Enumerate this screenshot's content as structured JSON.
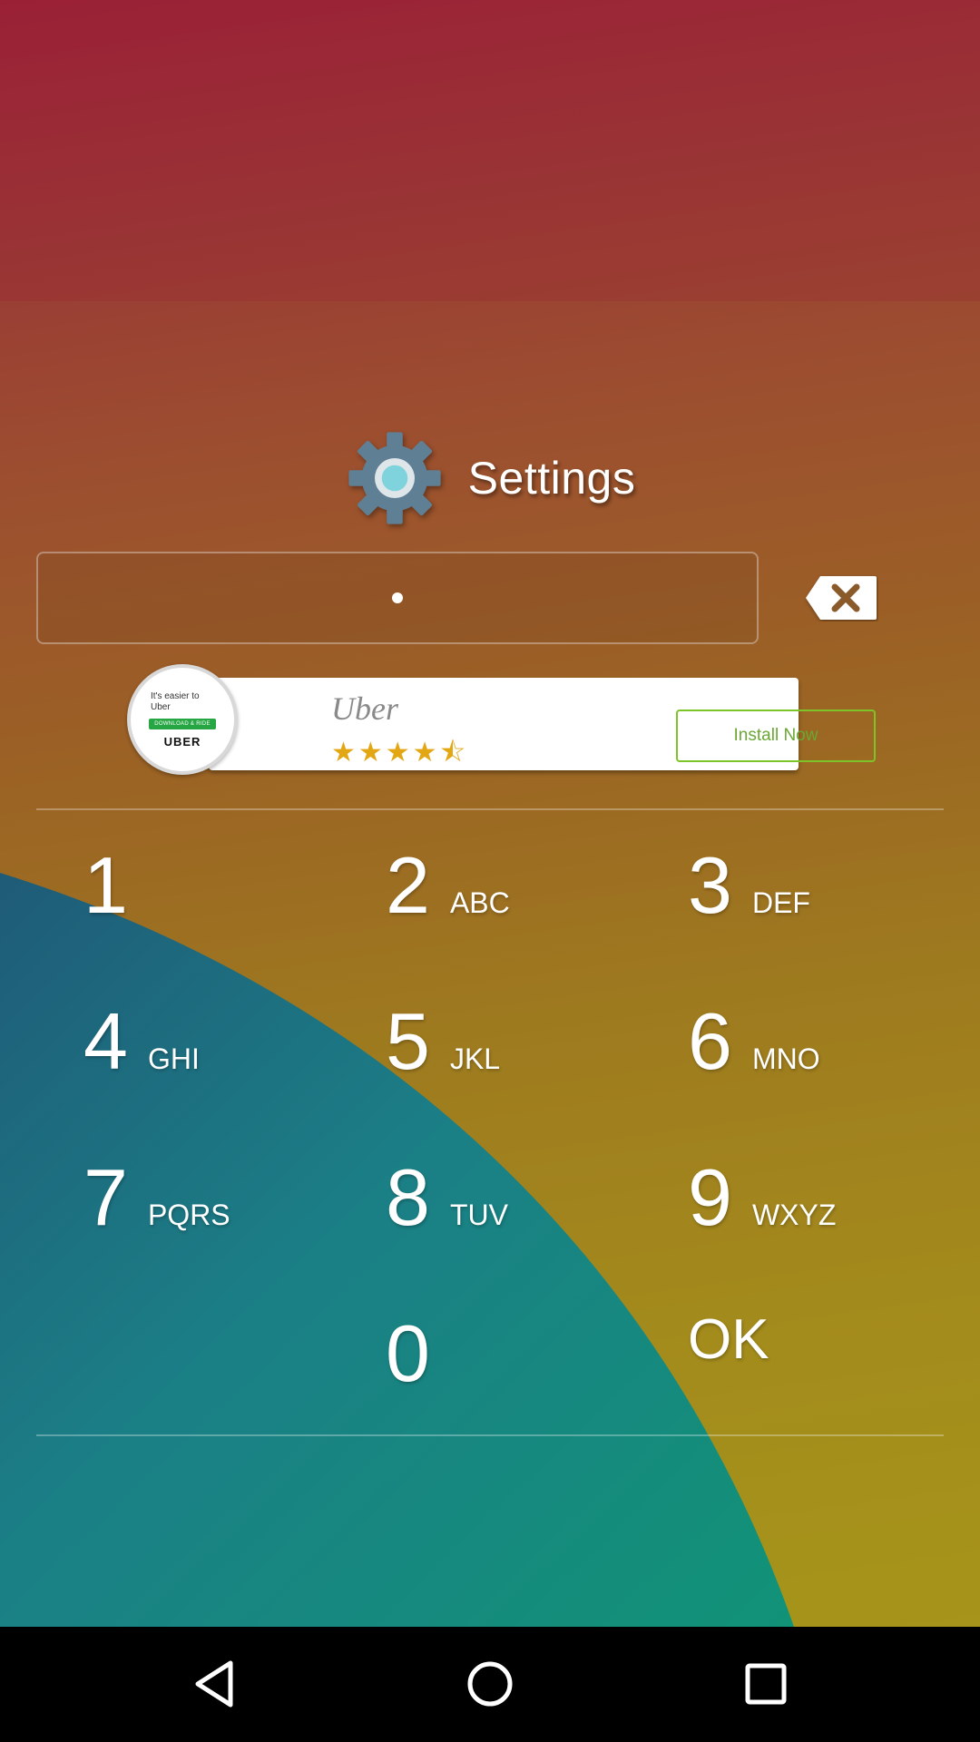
{
  "header": {
    "title": "Settings",
    "icon": "gear-icon"
  },
  "pin": {
    "masked_value": "•"
  },
  "ad": {
    "badge_tagline": "It's easier to Uber",
    "badge_button": "DOWNLOAD & RIDE",
    "badge_logo": "UBER",
    "app_name": "Uber",
    "stars": "★★★★⯪",
    "rating_stars": 4.5,
    "install_label": "Install Now"
  },
  "keypad": [
    {
      "digit": "1",
      "letters": ""
    },
    {
      "digit": "2",
      "letters": "ABC"
    },
    {
      "digit": "3",
      "letters": "DEF"
    },
    {
      "digit": "4",
      "letters": "GHI"
    },
    {
      "digit": "5",
      "letters": "JKL"
    },
    {
      "digit": "6",
      "letters": "MNO"
    },
    {
      "digit": "7",
      "letters": "PQRS"
    },
    {
      "digit": "8",
      "letters": "TUV"
    },
    {
      "digit": "9",
      "letters": "WXYZ"
    },
    {
      "digit": "0",
      "letters": ""
    },
    {
      "digit": "OK",
      "letters": ""
    }
  ],
  "navbar": {
    "back": "back-icon",
    "home": "home-icon",
    "recents": "recents-icon"
  },
  "colors": {
    "accent_green": "#7cc42a",
    "teal": "#1e7b84",
    "navbar": "#000000"
  }
}
